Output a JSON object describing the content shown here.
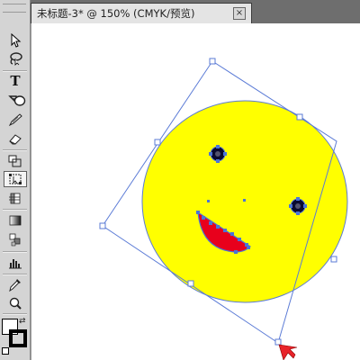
{
  "document": {
    "tab_title": "未标题-3* @ 150% (CMYK/预览)",
    "close_label": "×"
  },
  "toolbar": {
    "tools": [
      {
        "name": "direct-selection-tool",
        "icon": "arrow-icon"
      },
      {
        "name": "lasso-tool",
        "icon": "lasso-icon"
      },
      {
        "name": "type-tool",
        "icon": "type-icon",
        "glyph": "T"
      },
      {
        "name": "rectangle-tool",
        "icon": "rectangle-icon"
      },
      {
        "name": "ellipse-tool",
        "icon": "ellipse-icon"
      },
      {
        "name": "pencil-tool",
        "icon": "pencil-icon"
      },
      {
        "name": "eraser-tool",
        "icon": "eraser-icon"
      },
      {
        "name": "scale-tool",
        "icon": "scale-icon"
      },
      {
        "name": "free-transform-tool",
        "icon": "free-transform-icon",
        "active": true
      },
      {
        "name": "shape-builder-tool",
        "icon": "shape-builder-icon"
      },
      {
        "name": "gradient-tool",
        "icon": "gradient-icon"
      },
      {
        "name": "blend-tool",
        "icon": "blend-icon"
      },
      {
        "name": "column-graph-tool",
        "icon": "bar-graph-icon"
      },
      {
        "name": "eyedropper-tool",
        "icon": "eyedropper-icon"
      },
      {
        "name": "zoom-tool",
        "icon": "zoom-icon"
      }
    ],
    "fill_stroke": {
      "fill": "#ffffff",
      "stroke": "#000000"
    }
  },
  "artwork": {
    "face_color": "#ffff00",
    "mouth_color": "#e8001c",
    "eye_color": "#0a0a30",
    "selection_color": "#4a74d8",
    "cursor_color": "#e8232a"
  }
}
